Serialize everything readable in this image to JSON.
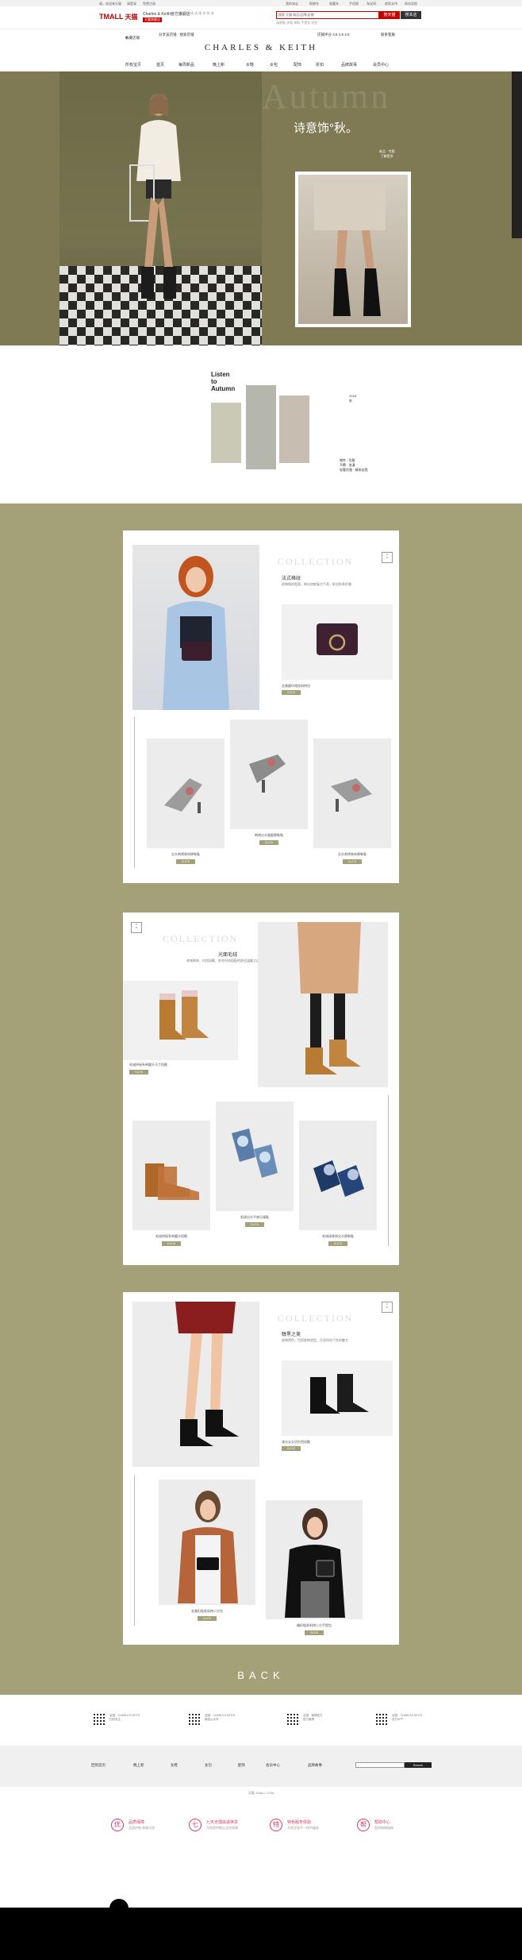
{
  "topbar": {
    "left": [
      "喵，欢迎来天猫",
      "请登录",
      "免费注册"
    ],
    "right": [
      "我的淘宝",
      "购物车",
      "收藏夹",
      "手机版",
      "淘宝网",
      "商家支持",
      "网站导航"
    ]
  },
  "header": {
    "tmall_logo": "TMALL",
    "tmall_cn": "天猫",
    "store_name": "Charles & Keith官方旗舰店",
    "store_badge": "天猫旗舰店",
    "store_info": "描 述 服 务 物 流",
    "search_placeholder": "搜索 天猫 商品/品牌/店铺",
    "search_tmall": "搜天猫",
    "search_store": "搜本店",
    "hot_words": "高跟鞋 凉鞋 单鞋 手提包 钱包"
  },
  "storebar": {
    "left": "收藏店铺",
    "left2": "分享该店铺 · 搜索店铺",
    "right": "店铺评分 4.8 4.8 4.8",
    "right2": "联系客服"
  },
  "brand": "CHARLES & KEITH",
  "nav": [
    "所有宝贝",
    "首页",
    "每周新品",
    "晚上新",
    "女鞋",
    "女包",
    "配饰",
    "折扣",
    "品牌故事",
    "会员中心"
  ],
  "hero": {
    "watermark": "Autumn",
    "title": "诗意饰°秋。",
    "sub1": "新品 · 专题",
    "sub2": "了解更多"
  },
  "listen": {
    "title": [
      "Listen",
      "to",
      "Autumn"
    ],
    "side_text": [
      "2018",
      "秋"
    ],
    "side_text2": [
      "感性 · 优雅",
      "不羁 · 浪漫",
      "轻奢优雅 · 精致自我"
    ]
  },
  "sections": [
    {
      "collection": "COLLECTION",
      "subtitle": "法式格纹",
      "desc": "经典格纹图案，带出浓郁复古气息，彰显秋季优雅",
      "brand_box": [
        "C",
        "K"
      ],
      "feature_name": "金属圆环格纹斜挎包",
      "products": [
        {
          "name": "尖头刺绣装饰穆勒鞋",
          "btn": "CLICK"
        },
        {
          "name": "刺绣尖头猫跟穆勒鞋",
          "btn": "CLICK"
        },
        {
          "name": "尖头刺绣装饰穆勒鞋",
          "btn": "CLICK"
        }
      ],
      "feature_btn": "CLICK"
    },
    {
      "collection": "COLLECTION",
      "subtitle": "光面毛绒",
      "desc": "毛绒装饰、时尚短靴，秋冬时尚搭配的舒适温暖之选",
      "brand_box": [
        "C",
        "K"
      ],
      "feature_name": "毛绒拼接系带圆头马丁短靴",
      "feature_btn": "CLICK",
      "products": [
        {
          "name": "毛绒拼接系带圆头短靴",
          "btn": "CLICK"
        },
        {
          "name": "毛球尖头平底乐福鞋",
          "btn": "CLICK"
        },
        {
          "name": "毛绒球装饰尖头穆勒鞋",
          "btn": "CLICK"
        }
      ]
    },
    {
      "collection": "COLLECTION",
      "subtitle": "醇黑之美",
      "desc": "经典黑色，百搭各种造型，尽显时尚个性的魅力",
      "brand_box": [
        "C",
        "K"
      ],
      "feature_name": "漆光尖头切尔西短靴",
      "feature_btn": "CLICK",
      "products": [
        {
          "name": "金属扣链条斜挎小方包",
          "btn": "CLICK"
        },
        {
          "name": "编织链条斜挎小方手提包",
          "btn": "CLICK"
        }
      ]
    }
  ],
  "back": "BACK",
  "footer": {
    "qr": [
      {
        "line1": "全国：CHARLES KEITH",
        "line2": "扫码关注"
      },
      {
        "line1": "全国：CHARLES KEITH",
        "line2": "微信公众号"
      },
      {
        "line1": "全国：微博官方",
        "line2": "官方微博"
      },
      {
        "line1": "全国：CHARLES KEITH",
        "line2": "官方APP"
      }
    ],
    "nav": [
      "回到首页",
      "晚上新",
      "女鞋",
      "女包",
      "配饰",
      "会员中心",
      "品牌故事"
    ],
    "search_btn": "Search",
    "powered": "天猫 TMALL.COM",
    "guarantees": [
      {
        "icon": "优",
        "title": "品质保障",
        "sub": "品质护航 购物无忧"
      },
      {
        "icon": "七",
        "title": "七天无理由退换货",
        "sub": "为您提供售后无忧保障"
      },
      {
        "icon": "特",
        "title": "特色服务体验",
        "sub": "为您呈现不一样的服务"
      },
      {
        "icon": "帮",
        "title": "帮助中心",
        "sub": "您的购物指南"
      }
    ]
  },
  "colors": {
    "tmall_red": "#c40000",
    "olive": "#a4a078",
    "hero_olive": "#7f7a54",
    "guarantee_pink": "#d63a63"
  }
}
